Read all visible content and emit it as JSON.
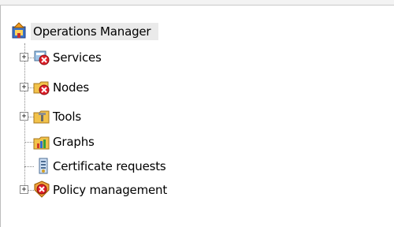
{
  "tree": {
    "root": {
      "label": "Operations Manager",
      "icon": "operations-manager-icon"
    },
    "items": [
      {
        "label": "Services",
        "icon": "services-error-icon",
        "expandable": true,
        "expander_symbol": "+"
      },
      {
        "label": "Nodes",
        "icon": "nodes-error-icon",
        "expandable": true,
        "expander_symbol": "+"
      },
      {
        "label": "Tools",
        "icon": "tools-folder-icon",
        "expandable": true,
        "expander_symbol": "+"
      },
      {
        "label": "Graphs",
        "icon": "graphs-icon",
        "expandable": false
      },
      {
        "label": "Certificate requests",
        "icon": "certificate-requests-icon",
        "expandable": false
      },
      {
        "label": "Policy management",
        "icon": "policy-management-error-icon",
        "expandable": true,
        "expander_symbol": "+"
      }
    ]
  },
  "colors": {
    "error_badge": "#e0202a",
    "folder": "#f2c24a",
    "root_highlight": "#eaeaea"
  }
}
